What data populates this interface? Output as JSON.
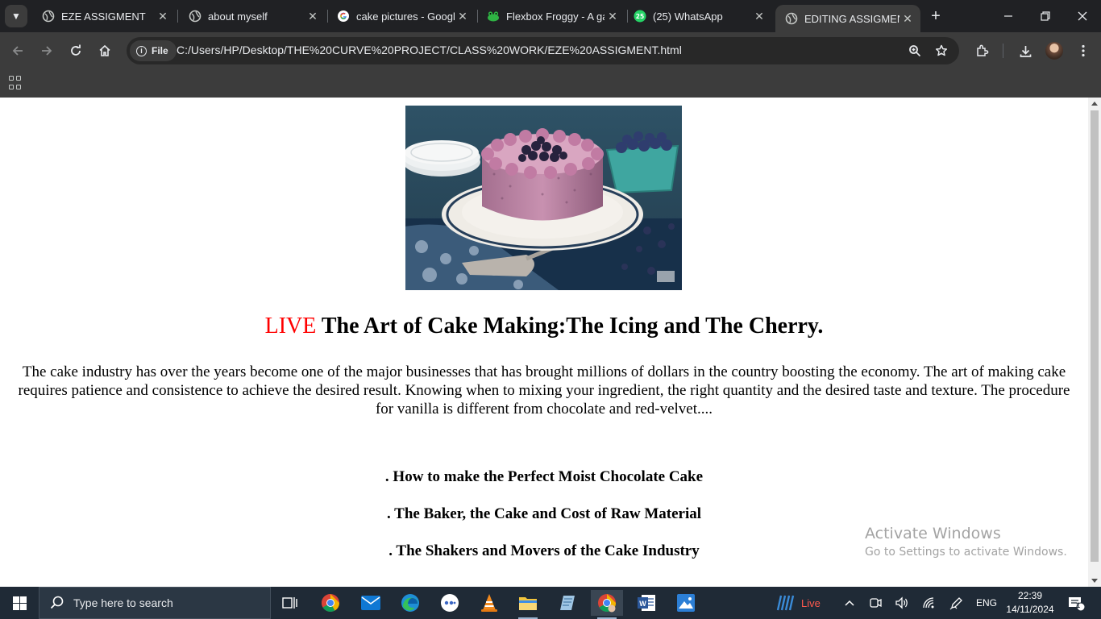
{
  "browser": {
    "tabs": [
      {
        "title": "EZE ASSIGMENT",
        "active": false
      },
      {
        "title": "about myself",
        "active": false
      },
      {
        "title": "cake pictures - Googl",
        "active": false
      },
      {
        "title": "Flexbox Froggy - A ga",
        "active": false
      },
      {
        "title": "(25) WhatsApp",
        "active": false
      },
      {
        "title": "EDITING ASSIGMENT",
        "active": true
      }
    ],
    "whatsapp_badge": "25",
    "url_chip": "File",
    "url": "C:/Users/HP/Desktop/THE%20CURVE%20PROJECT/CLASS%20WORK/EZE%20ASSIGMENT.html"
  },
  "page": {
    "heading_live": "LIVE",
    "heading_rest": " The Art of Cake Making:The Icing and The Cherry.",
    "paragraph": "The cake industry has over the years become one of the major businesses that has brought millions of dollars in the country boosting the economy. The art of making cake requires patience and consistence to achieve the desired result. Knowing when to mixing your ingredient, the right quantity and the desired taste and texture. The procedure for vanilla is different from chocolate and red-velvet....",
    "topics": [
      ". How to make the Perfect Moist Chocolate Cake",
      ". The Baker, the Cake and Cost of Raw Material",
      ". The Shakers and Movers of the Cake Industry"
    ]
  },
  "watermark": {
    "line1": "Activate Windows",
    "line2": "Go to Settings to activate Windows."
  },
  "taskbar": {
    "search_placeholder": "Type here to search",
    "weather_label": "Live",
    "language": "ENG",
    "time": "22:39",
    "date": "14/11/2024",
    "notification_count": "1"
  },
  "colors": {
    "live_red": "#ff0000",
    "chrome_dark": "#202124",
    "chrome_toolbar": "#3c3c3c",
    "taskbar": "#1f2a36"
  }
}
